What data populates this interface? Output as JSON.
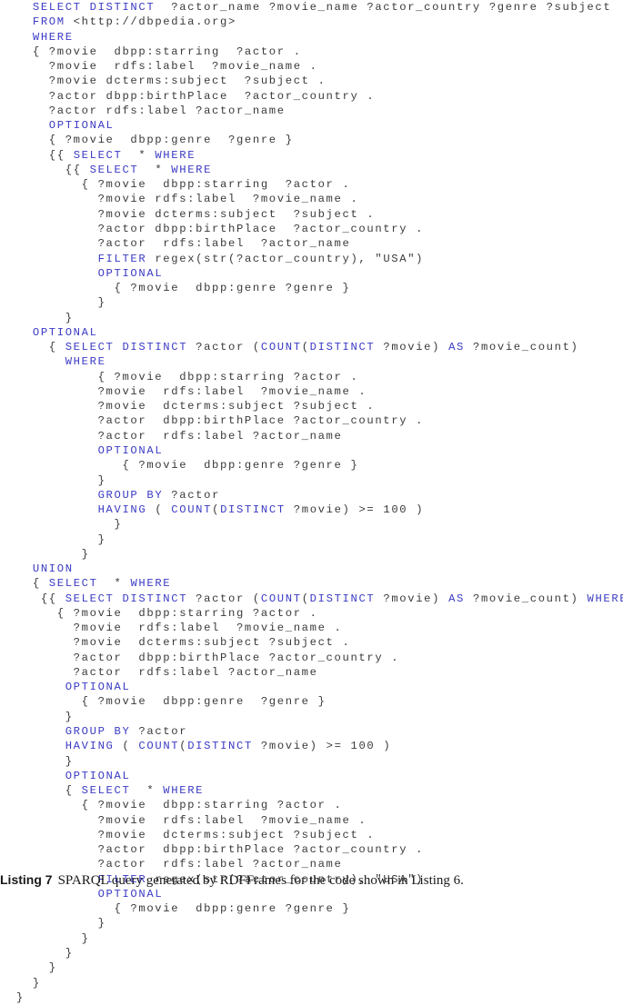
{
  "listing": {
    "language": "SPARQL",
    "keyword_color": "#3b3bc4",
    "text_color": "#3a3a3a",
    "lines": [
      [
        [
          "    ",
          ""
        ],
        [
          "SELECT DISTINCT",
          "kw"
        ],
        [
          "  ?actor_name ?movie_name ?actor_country ?genre ?subject",
          ""
        ]
      ],
      [
        [
          "    ",
          ""
        ],
        [
          "FROM",
          "kw"
        ],
        [
          " <http://dbpedia.org>",
          ""
        ]
      ],
      [
        [
          "    ",
          ""
        ],
        [
          "WHERE",
          "kw"
        ]
      ],
      [
        [
          "    { ?movie  dbpp:starring  ?actor .",
          ""
        ]
      ],
      [
        [
          "      ?movie  rdfs:label  ?movie_name .",
          ""
        ]
      ],
      [
        [
          "      ?movie dcterms:subject  ?subject .",
          ""
        ]
      ],
      [
        [
          "      ?actor dbpp:birthPlace  ?actor_country .",
          ""
        ]
      ],
      [
        [
          "      ?actor rdfs:label ?actor_name",
          ""
        ]
      ],
      [
        [
          "      ",
          ""
        ],
        [
          "OPTIONAL",
          "kw"
        ]
      ],
      [
        [
          "      { ?movie  dbpp:genre  ?genre }",
          ""
        ]
      ],
      [
        [
          "      {{ ",
          ""
        ],
        [
          "SELECT",
          "kw"
        ],
        [
          "  * ",
          ""
        ],
        [
          "WHERE",
          "kw"
        ]
      ],
      [
        [
          "        {{ ",
          ""
        ],
        [
          "SELECT",
          "kw"
        ],
        [
          "  * ",
          ""
        ],
        [
          "WHERE",
          "kw"
        ]
      ],
      [
        [
          "          { ?movie  dbpp:starring  ?actor .",
          ""
        ]
      ],
      [
        [
          "            ?movie rdfs:label  ?movie_name .",
          ""
        ]
      ],
      [
        [
          "            ?movie dcterms:subject  ?subject .",
          ""
        ]
      ],
      [
        [
          "            ?actor dbpp:birthPlace  ?actor_country .",
          ""
        ]
      ],
      [
        [
          "            ?actor  rdfs:label  ?actor_name",
          ""
        ]
      ],
      [
        [
          "            ",
          ""
        ],
        [
          "FILTER",
          "kw"
        ],
        [
          " regex(str(?actor_country), \"USA\")",
          ""
        ]
      ],
      [
        [
          "            ",
          ""
        ],
        [
          "OPTIONAL",
          "kw"
        ]
      ],
      [
        [
          "              { ?movie  dbpp:genre ?genre }",
          ""
        ]
      ],
      [
        [
          "            }",
          ""
        ]
      ],
      [
        [
          "        }",
          ""
        ]
      ],
      [
        [
          "    ",
          ""
        ],
        [
          "OPTIONAL",
          "kw"
        ]
      ],
      [
        [
          "      { ",
          ""
        ],
        [
          "SELECT DISTINCT",
          "kw"
        ],
        [
          " ?actor (",
          ""
        ],
        [
          "COUNT",
          "kw"
        ],
        [
          "(",
          ""
        ],
        [
          "DISTINCT",
          "kw"
        ],
        [
          " ?movie) ",
          ""
        ],
        [
          "AS",
          "kw"
        ],
        [
          " ?movie_count)",
          ""
        ]
      ],
      [
        [
          "        ",
          ""
        ],
        [
          "WHERE",
          "kw"
        ]
      ],
      [
        [
          "            { ?movie  dbpp:starring ?actor .",
          ""
        ]
      ],
      [
        [
          "            ?movie  rdfs:label  ?movie_name .",
          ""
        ]
      ],
      [
        [
          "            ?movie  dcterms:subject ?subject .",
          ""
        ]
      ],
      [
        [
          "            ?actor  dbpp:birthPlace ?actor_country .",
          ""
        ]
      ],
      [
        [
          "            ?actor  rdfs:label ?actor_name",
          ""
        ]
      ],
      [
        [
          "            ",
          ""
        ],
        [
          "OPTIONAL",
          "kw"
        ]
      ],
      [
        [
          "               { ?movie  dbpp:genre ?genre }",
          ""
        ]
      ],
      [
        [
          "            }",
          ""
        ]
      ],
      [
        [
          "            ",
          ""
        ],
        [
          "GROUP BY",
          "kw"
        ],
        [
          " ?actor",
          ""
        ]
      ],
      [
        [
          "            ",
          ""
        ],
        [
          "HAVING",
          "kw"
        ],
        [
          " ( ",
          ""
        ],
        [
          "COUNT",
          "kw"
        ],
        [
          "(",
          ""
        ],
        [
          "DISTINCT",
          "kw"
        ],
        [
          " ?movie) >= 100 )",
          ""
        ]
      ],
      [
        [
          "              }",
          ""
        ]
      ],
      [
        [
          "            }",
          ""
        ]
      ],
      [
        [
          "          }",
          ""
        ]
      ],
      [
        [
          "    ",
          ""
        ],
        [
          "UNION",
          "kw"
        ]
      ],
      [
        [
          "    { ",
          ""
        ],
        [
          "SELECT",
          "kw"
        ],
        [
          "  * ",
          ""
        ],
        [
          "WHERE",
          "kw"
        ]
      ],
      [
        [
          "     {{ ",
          ""
        ],
        [
          "SELECT DISTINCT",
          "kw"
        ],
        [
          " ?actor (",
          ""
        ],
        [
          "COUNT",
          "kw"
        ],
        [
          "(",
          ""
        ],
        [
          "DISTINCT",
          "kw"
        ],
        [
          " ?movie) ",
          ""
        ],
        [
          "AS",
          "kw"
        ],
        [
          " ?movie_count) ",
          ""
        ],
        [
          "WHERE",
          "kw"
        ]
      ],
      [
        [
          "       { ?movie  dbpp:starring ?actor .",
          ""
        ]
      ],
      [
        [
          "         ?movie  rdfs:label  ?movie_name .",
          ""
        ]
      ],
      [
        [
          "         ?movie  dcterms:subject ?subject .",
          ""
        ]
      ],
      [
        [
          "         ?actor  dbpp:birthPlace ?actor_country .",
          ""
        ]
      ],
      [
        [
          "         ?actor  rdfs:label ?actor_name",
          ""
        ]
      ],
      [
        [
          "        ",
          ""
        ],
        [
          "OPTIONAL",
          "kw"
        ]
      ],
      [
        [
          "          { ?movie  dbpp:genre  ?genre }",
          ""
        ]
      ],
      [
        [
          "        }",
          ""
        ]
      ],
      [
        [
          "        ",
          ""
        ],
        [
          "GROUP BY",
          "kw"
        ],
        [
          " ?actor",
          ""
        ]
      ],
      [
        [
          "        ",
          ""
        ],
        [
          "HAVING",
          "kw"
        ],
        [
          " ( ",
          ""
        ],
        [
          "COUNT",
          "kw"
        ],
        [
          "(",
          ""
        ],
        [
          "DISTINCT",
          "kw"
        ],
        [
          " ?movie) >= 100 )",
          ""
        ]
      ],
      [
        [
          "        }",
          ""
        ]
      ],
      [
        [
          "        ",
          ""
        ],
        [
          "OPTIONAL",
          "kw"
        ]
      ],
      [
        [
          "        { ",
          ""
        ],
        [
          "SELECT",
          "kw"
        ],
        [
          "  * ",
          ""
        ],
        [
          "WHERE",
          "kw"
        ]
      ],
      [
        [
          "          { ?movie  dbpp:starring ?actor .",
          ""
        ]
      ],
      [
        [
          "            ?movie  rdfs:label  ?movie_name .",
          ""
        ]
      ],
      [
        [
          "            ?movie  dcterms:subject ?subject .",
          ""
        ]
      ],
      [
        [
          "            ?actor  dbpp:birthPlace ?actor_country .",
          ""
        ]
      ],
      [
        [
          "            ?actor  rdfs:label ?actor_name",
          ""
        ]
      ],
      [
        [
          "            ",
          ""
        ],
        [
          "FILTER",
          "kw"
        ],
        [
          " regex(str(?actor_country), \"USA\")",
          ""
        ]
      ],
      [
        [
          "            ",
          ""
        ],
        [
          "OPTIONAL",
          "kw"
        ]
      ],
      [
        [
          "              { ?movie  dbpp:genre ?genre }",
          ""
        ]
      ],
      [
        [
          "            }",
          ""
        ]
      ],
      [
        [
          "          }",
          ""
        ]
      ],
      [
        [
          "        }",
          ""
        ]
      ],
      [
        [
          "      }",
          ""
        ]
      ],
      [
        [
          "    }",
          ""
        ]
      ],
      [
        [
          "  }",
          ""
        ]
      ]
    ]
  },
  "caption": {
    "label": "Listing 7",
    "text": "SPARQL query generated by RDFFrames for the code shown in Listing 6."
  }
}
